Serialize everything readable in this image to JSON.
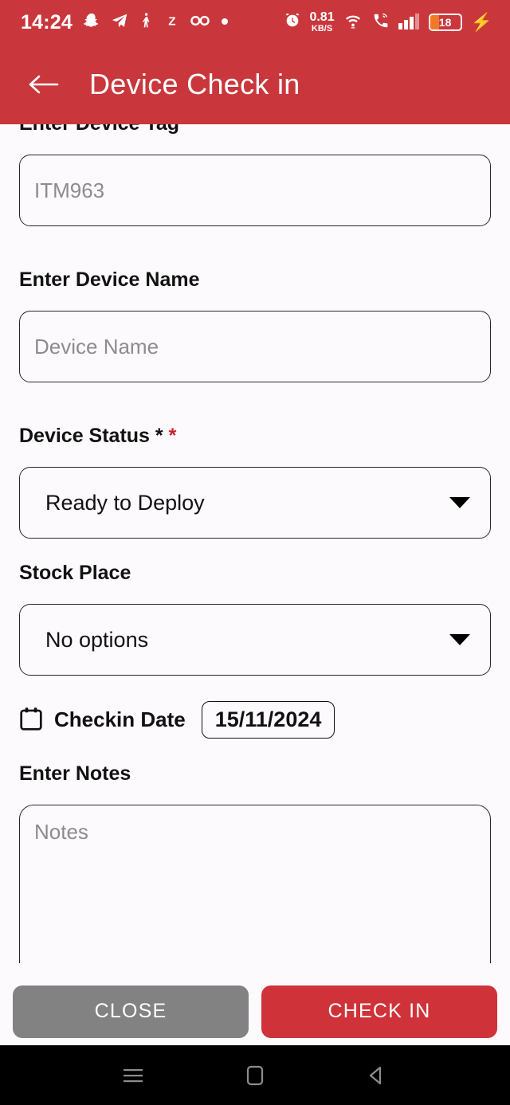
{
  "status_bar": {
    "time": "14:24",
    "left_icons": [
      "snapchat-icon",
      "telegram-icon",
      "person-icon",
      "letter-z-icon",
      "glasses-icon",
      "dot-icon"
    ],
    "alarm_icon": "alarm-icon",
    "net_speed_value": "0.81",
    "net_speed_unit": "KB/S",
    "wifi_icon": "wifi-icon",
    "call_icon": "call-wifi-icon",
    "signal_icon": "signal-bars-icon",
    "battery_level": "18",
    "charging_icon": "charging-bolt-icon",
    "battery_fill_color": "#f07a28",
    "charging_color": "#3ddd4b"
  },
  "app_bar": {
    "back_icon": "back-arrow-icon",
    "title": "Device Check in",
    "background_color": "#c9373c"
  },
  "form": {
    "device_tag": {
      "label": "Enter Device Tag",
      "required_marker": "*",
      "placeholder": "ITM963",
      "value": ""
    },
    "device_name": {
      "label": "Enter Device Name",
      "placeholder": "Device Name",
      "value": ""
    },
    "device_status": {
      "label": "Device Status *",
      "required_marker": "*",
      "selected": "Ready to Deploy",
      "caret_icon": "chevron-down-icon"
    },
    "stock_place": {
      "label": "Stock Place",
      "selected": "No options",
      "caret_icon": "chevron-down-icon"
    },
    "checkin_date": {
      "icon": "calendar-icon",
      "label": "Checkin Date",
      "value": "15/11/2024"
    },
    "notes": {
      "label": "Enter Notes",
      "placeholder": "Notes",
      "value": ""
    }
  },
  "actions": {
    "close_label": "CLOSE",
    "close_color": "#828282",
    "checkin_label": "CHECK IN",
    "checkin_color": "#cf3339"
  },
  "nav_bar": {
    "recents_icon": "recents-icon",
    "home_icon": "home-icon",
    "back_icon": "back-triangle-icon"
  }
}
